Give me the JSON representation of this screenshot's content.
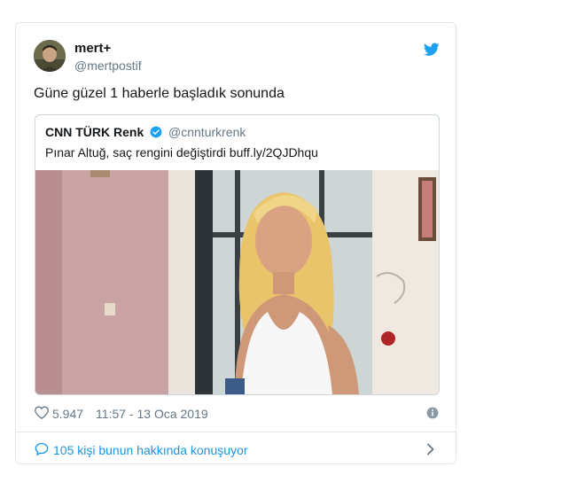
{
  "tweet": {
    "author_name": "mert+",
    "author_handle": "@mertpostif",
    "text": "Güne güzel 1 haberle başladık sonunda",
    "quote": {
      "author_name": "CNN TÜRK Renk",
      "author_handle": "@cnnturkrenk",
      "text": "Pınar Altuğ, saç rengini değiştirdi buff.ly/2QJDhqu"
    },
    "likes": "5.947",
    "timestamp": "11:57 - 13 Oca 2019",
    "conversation_text": "105 kişi bunun hakkında konuşuyor"
  },
  "icons": [
    "twitter-bird-icon",
    "verified-badge-icon",
    "heart-icon",
    "info-icon",
    "reply-bubble-icon",
    "chevron-right-icon"
  ],
  "colors": {
    "brand": "#1da1f2",
    "link": "#1b95e0",
    "muted": "#657786",
    "border": "#e1e8ed"
  }
}
